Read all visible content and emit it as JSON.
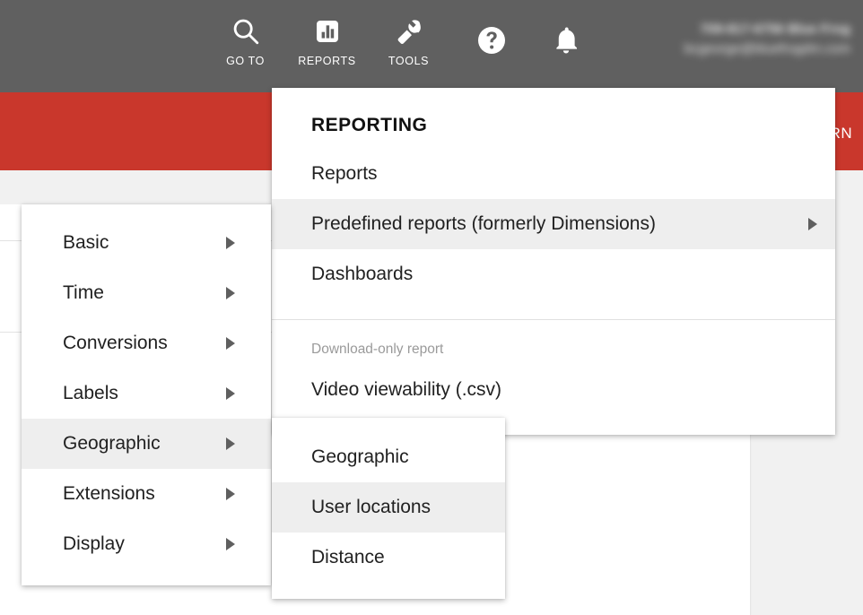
{
  "topbar": {
    "nav_items": [
      {
        "label": "GO TO",
        "icon": "search-icon"
      },
      {
        "label": "REPORTS",
        "icon": "bar-chart-icon"
      },
      {
        "label": "TOOLS",
        "icon": "wrench-icon"
      }
    ],
    "util_icons": [
      {
        "name": "help-icon"
      },
      {
        "name": "notifications-bell-icon"
      }
    ],
    "account": {
      "line1": "709-817-6756 Blue Frog",
      "line2": "bcgeorge@bluefrogdm.com",
      "redacted": true
    },
    "background_color": "#606060"
  },
  "banner": {
    "action_label": "RN",
    "background_color": "#c9372c"
  },
  "reporting_menu": {
    "title": "REPORTING",
    "items": [
      {
        "label": "Reports",
        "has_submenu": false,
        "hovered": false
      },
      {
        "label": "Predefined reports (formerly Dimensions)",
        "has_submenu": true,
        "hovered": true
      },
      {
        "label": "Dashboards",
        "has_submenu": false,
        "hovered": false
      }
    ],
    "section_label": "Download-only report",
    "download_items": [
      {
        "label": "Video viewability (.csv)",
        "has_submenu": false,
        "hovered": false
      }
    ]
  },
  "predefined_menu": {
    "items": [
      {
        "label": "Basic",
        "has_submenu": true,
        "hovered": false
      },
      {
        "label": "Time",
        "has_submenu": true,
        "hovered": false
      },
      {
        "label": "Conversions",
        "has_submenu": true,
        "hovered": false
      },
      {
        "label": "Labels",
        "has_submenu": true,
        "hovered": false
      },
      {
        "label": "Geographic",
        "has_submenu": true,
        "hovered": true
      },
      {
        "label": "Extensions",
        "has_submenu": true,
        "hovered": false
      },
      {
        "label": "Display",
        "has_submenu": true,
        "hovered": false
      }
    ]
  },
  "geographic_menu": {
    "items": [
      {
        "label": "Geographic",
        "hovered": false
      },
      {
        "label": "User locations",
        "hovered": true
      },
      {
        "label": "Distance",
        "hovered": false
      }
    ]
  },
  "colors": {
    "topbar": "#606060",
    "banner_red": "#c9372c",
    "page_background": "#f1f1f1",
    "menu_background": "#ffffff",
    "menu_hover": "#eeeeee",
    "text_primary": "#212121",
    "text_muted": "#9a9a9a"
  }
}
